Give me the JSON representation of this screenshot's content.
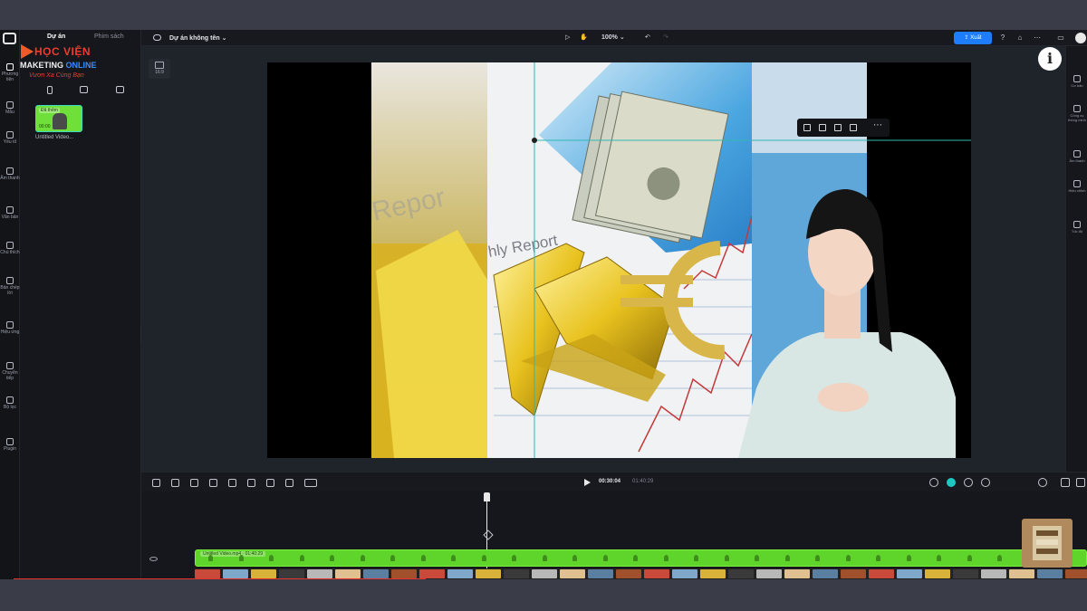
{
  "panel": {
    "tabs": [
      "Dự án",
      "Phim sách"
    ],
    "clip": {
      "tag": "Đã thêm",
      "duration": "00:00",
      "name": "Untitled Video..."
    }
  },
  "watermark": {
    "line1": "HỌC VIỆN",
    "line2a": "MAKETING ",
    "line2b": "ONLINE",
    "line3": "Vươn Xa Cùng Bạn"
  },
  "rail": [
    {
      "label": "Phương tiện",
      "icon": "media-icon"
    },
    {
      "label": "Mẫu",
      "icon": "template-icon"
    },
    {
      "label": "Yếu tố",
      "icon": "elements-icon"
    },
    {
      "label": "Âm thanh",
      "icon": "audio-icon"
    },
    {
      "label": "Văn bản",
      "icon": "text-icon"
    },
    {
      "label": "Chú thích",
      "icon": "captions-icon"
    },
    {
      "label": "Bản chép lời",
      "icon": "transcript-icon"
    },
    {
      "label": "Hiệu ứng",
      "icon": "effects-icon"
    },
    {
      "label": "Chuyển tiếp",
      "icon": "transition-icon"
    },
    {
      "label": "Bộ lọc",
      "icon": "filter-icon"
    },
    {
      "label": "Plugin",
      "icon": "plugin-icon"
    }
  ],
  "topbar": {
    "title": "Dự án không tên",
    "zoom": "100%",
    "export_label": "Xuất"
  },
  "preview": {
    "ratio_label": "16:9"
  },
  "rrail": [
    {
      "label": "Cơ bản",
      "icon": "basic-icon"
    },
    {
      "label": "Công cụ thông minh",
      "icon": "smart-tools-icon"
    },
    {
      "label": "Âm thanh",
      "icon": "audio-icon"
    },
    {
      "label": "Hiệu chỉnh",
      "icon": "adjust-icon"
    },
    {
      "label": "Tốc độ",
      "icon": "speed-icon"
    }
  ],
  "timeline": {
    "current_time": "00:30:04",
    "total_time": "01:40:29",
    "track_label": "Untitled Video.mp4 · 01:40:29"
  },
  "colors": {
    "accent": "#1d7dfa",
    "track": "#5fd42b",
    "teal": "#1ec7c2"
  }
}
